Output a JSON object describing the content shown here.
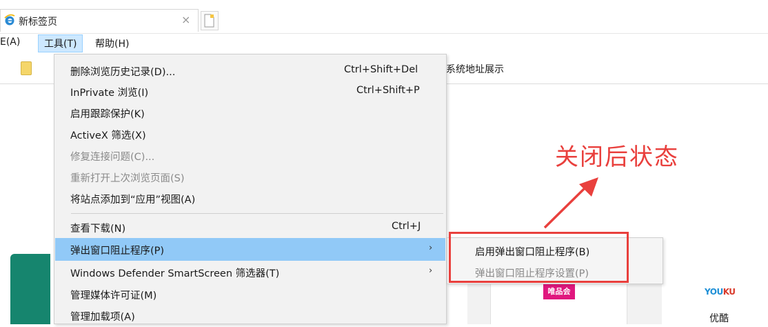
{
  "tab": {
    "title": "新标签页",
    "close_symbol": "×",
    "icon": "ie-icon",
    "new_tab_icon": "new-tab-icon"
  },
  "menubar": {
    "cut_item": "E(A)",
    "tools": "工具(T)",
    "help": "帮助(H)"
  },
  "favorites": {
    "folder_icon": "folder-icon",
    "visible_text": "系统地址展示"
  },
  "tools_menu": {
    "items": [
      {
        "label": "删除浏览历史记录(D)...",
        "shortcut": "Ctrl+Shift+Del",
        "enabled": true
      },
      {
        "label": "InPrivate 浏览(I)",
        "shortcut": "Ctrl+Shift+P",
        "enabled": true
      },
      {
        "label": "启用跟踪保护(K)",
        "shortcut": "",
        "enabled": true
      },
      {
        "label": "ActiveX 筛选(X)",
        "shortcut": "",
        "enabled": true
      },
      {
        "label": "修复连接问题(C)...",
        "shortcut": "",
        "enabled": false
      },
      {
        "label": "重新打开上次浏览页面(S)",
        "shortcut": "",
        "enabled": false
      },
      {
        "label": "将站点添加到“应用”视图(A)",
        "shortcut": "",
        "enabled": true
      },
      {
        "label": "查看下载(N)",
        "shortcut": "Ctrl+J",
        "enabled": true
      },
      {
        "label": "弹出窗口阻止程序(P)",
        "shortcut": "",
        "enabled": true,
        "submenu": true,
        "highlighted": true
      },
      {
        "label": "Windows Defender SmartScreen 筛选器(T)",
        "shortcut": "",
        "enabled": true,
        "submenu": true
      },
      {
        "label": "管理媒体许可证(M)",
        "shortcut": "",
        "enabled": true
      },
      {
        "label": "管理加载项(A)",
        "shortcut": "",
        "enabled": true
      }
    ],
    "submenu_arrow": "›"
  },
  "popup_submenu": {
    "items": [
      {
        "label": "启用弹出窗口阻止程序(B)",
        "enabled": true
      },
      {
        "label": "弹出窗口阻止程序设置(P)",
        "enabled": false
      }
    ]
  },
  "annotation": {
    "text": "关闭后状态",
    "color": "#e9403d"
  },
  "tiles": {
    "vip_logo": "唯品会",
    "youku_logo_a": "YOU",
    "youku_logo_b": "KU",
    "youku_label": "优酷"
  },
  "colors": {
    "menu_highlight": "#91c9f7",
    "menubar_active": "#cde8ff",
    "green_tile": "#16856e",
    "vip_pink": "#e0177e"
  }
}
